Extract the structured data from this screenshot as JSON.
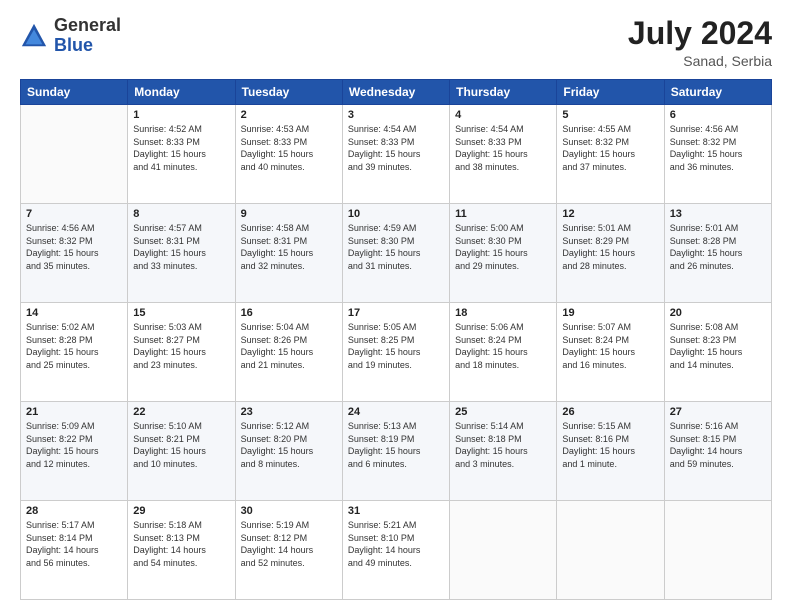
{
  "header": {
    "logo_general": "General",
    "logo_blue": "Blue",
    "month_year": "July 2024",
    "location": "Sanad, Serbia"
  },
  "columns": [
    "Sunday",
    "Monday",
    "Tuesday",
    "Wednesday",
    "Thursday",
    "Friday",
    "Saturday"
  ],
  "weeks": [
    [
      {
        "date": "",
        "info": ""
      },
      {
        "date": "1",
        "info": "Sunrise: 4:52 AM\nSunset: 8:33 PM\nDaylight: 15 hours\nand 41 minutes."
      },
      {
        "date": "2",
        "info": "Sunrise: 4:53 AM\nSunset: 8:33 PM\nDaylight: 15 hours\nand 40 minutes."
      },
      {
        "date": "3",
        "info": "Sunrise: 4:54 AM\nSunset: 8:33 PM\nDaylight: 15 hours\nand 39 minutes."
      },
      {
        "date": "4",
        "info": "Sunrise: 4:54 AM\nSunset: 8:33 PM\nDaylight: 15 hours\nand 38 minutes."
      },
      {
        "date": "5",
        "info": "Sunrise: 4:55 AM\nSunset: 8:32 PM\nDaylight: 15 hours\nand 37 minutes."
      },
      {
        "date": "6",
        "info": "Sunrise: 4:56 AM\nSunset: 8:32 PM\nDaylight: 15 hours\nand 36 minutes."
      }
    ],
    [
      {
        "date": "7",
        "info": "Sunrise: 4:56 AM\nSunset: 8:32 PM\nDaylight: 15 hours\nand 35 minutes."
      },
      {
        "date": "8",
        "info": "Sunrise: 4:57 AM\nSunset: 8:31 PM\nDaylight: 15 hours\nand 33 minutes."
      },
      {
        "date": "9",
        "info": "Sunrise: 4:58 AM\nSunset: 8:31 PM\nDaylight: 15 hours\nand 32 minutes."
      },
      {
        "date": "10",
        "info": "Sunrise: 4:59 AM\nSunset: 8:30 PM\nDaylight: 15 hours\nand 31 minutes."
      },
      {
        "date": "11",
        "info": "Sunrise: 5:00 AM\nSunset: 8:30 PM\nDaylight: 15 hours\nand 29 minutes."
      },
      {
        "date": "12",
        "info": "Sunrise: 5:01 AM\nSunset: 8:29 PM\nDaylight: 15 hours\nand 28 minutes."
      },
      {
        "date": "13",
        "info": "Sunrise: 5:01 AM\nSunset: 8:28 PM\nDaylight: 15 hours\nand 26 minutes."
      }
    ],
    [
      {
        "date": "14",
        "info": "Sunrise: 5:02 AM\nSunset: 8:28 PM\nDaylight: 15 hours\nand 25 minutes."
      },
      {
        "date": "15",
        "info": "Sunrise: 5:03 AM\nSunset: 8:27 PM\nDaylight: 15 hours\nand 23 minutes."
      },
      {
        "date": "16",
        "info": "Sunrise: 5:04 AM\nSunset: 8:26 PM\nDaylight: 15 hours\nand 21 minutes."
      },
      {
        "date": "17",
        "info": "Sunrise: 5:05 AM\nSunset: 8:25 PM\nDaylight: 15 hours\nand 19 minutes."
      },
      {
        "date": "18",
        "info": "Sunrise: 5:06 AM\nSunset: 8:24 PM\nDaylight: 15 hours\nand 18 minutes."
      },
      {
        "date": "19",
        "info": "Sunrise: 5:07 AM\nSunset: 8:24 PM\nDaylight: 15 hours\nand 16 minutes."
      },
      {
        "date": "20",
        "info": "Sunrise: 5:08 AM\nSunset: 8:23 PM\nDaylight: 15 hours\nand 14 minutes."
      }
    ],
    [
      {
        "date": "21",
        "info": "Sunrise: 5:09 AM\nSunset: 8:22 PM\nDaylight: 15 hours\nand 12 minutes."
      },
      {
        "date": "22",
        "info": "Sunrise: 5:10 AM\nSunset: 8:21 PM\nDaylight: 15 hours\nand 10 minutes."
      },
      {
        "date": "23",
        "info": "Sunrise: 5:12 AM\nSunset: 8:20 PM\nDaylight: 15 hours\nand 8 minutes."
      },
      {
        "date": "24",
        "info": "Sunrise: 5:13 AM\nSunset: 8:19 PM\nDaylight: 15 hours\nand 6 minutes."
      },
      {
        "date": "25",
        "info": "Sunrise: 5:14 AM\nSunset: 8:18 PM\nDaylight: 15 hours\nand 3 minutes."
      },
      {
        "date": "26",
        "info": "Sunrise: 5:15 AM\nSunset: 8:16 PM\nDaylight: 15 hours\nand 1 minute."
      },
      {
        "date": "27",
        "info": "Sunrise: 5:16 AM\nSunset: 8:15 PM\nDaylight: 14 hours\nand 59 minutes."
      }
    ],
    [
      {
        "date": "28",
        "info": "Sunrise: 5:17 AM\nSunset: 8:14 PM\nDaylight: 14 hours\nand 56 minutes."
      },
      {
        "date": "29",
        "info": "Sunrise: 5:18 AM\nSunset: 8:13 PM\nDaylight: 14 hours\nand 54 minutes."
      },
      {
        "date": "30",
        "info": "Sunrise: 5:19 AM\nSunset: 8:12 PM\nDaylight: 14 hours\nand 52 minutes."
      },
      {
        "date": "31",
        "info": "Sunrise: 5:21 AM\nSunset: 8:10 PM\nDaylight: 14 hours\nand 49 minutes."
      },
      {
        "date": "",
        "info": ""
      },
      {
        "date": "",
        "info": ""
      },
      {
        "date": "",
        "info": ""
      }
    ]
  ]
}
